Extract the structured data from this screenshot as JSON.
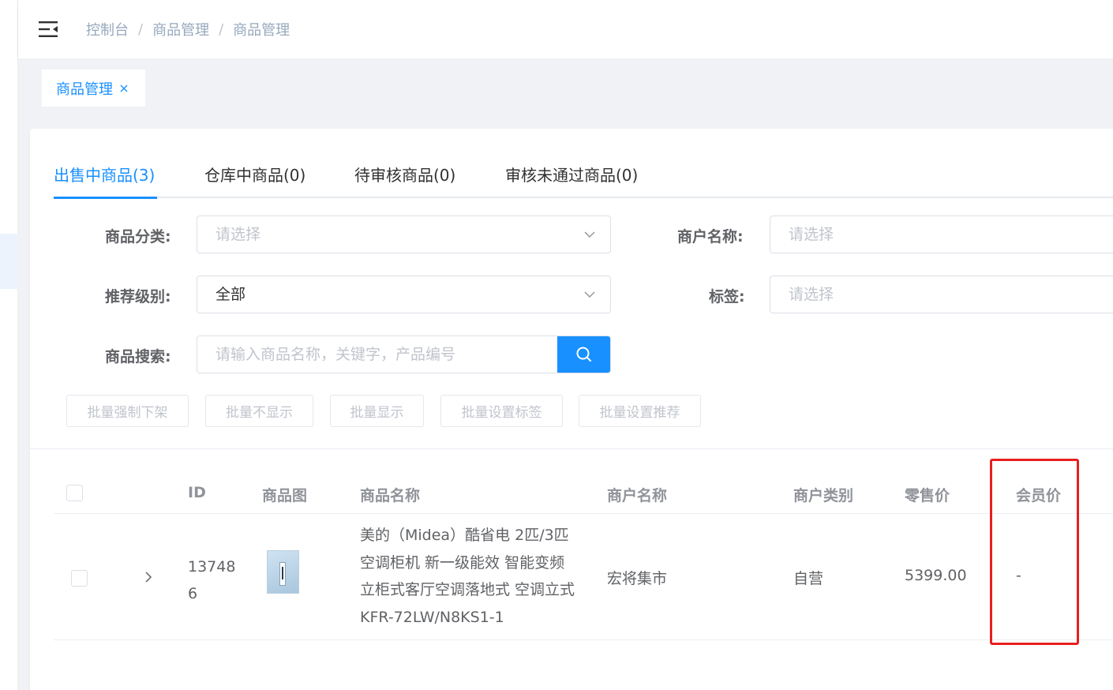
{
  "header": {
    "breadcrumb": [
      "控制台",
      "商品管理",
      "商品管理"
    ],
    "breadcrumb_sep": "/"
  },
  "tags": {
    "active_tag": "商品管理"
  },
  "tabs": [
    {
      "label": "出售中商品(3)",
      "active": true
    },
    {
      "label": "仓库中商品(0)",
      "active": false
    },
    {
      "label": "待审核商品(0)",
      "active": false
    },
    {
      "label": "审核未通过商品(0)",
      "active": false
    }
  ],
  "filters": {
    "category_label": "商品分类:",
    "category_placeholder": "请选择",
    "merchant_label": "商户名称:",
    "merchant_placeholder": "请选择",
    "recommend_label": "推荐级别:",
    "recommend_value": "全部",
    "tag_label": "标签:",
    "tag_placeholder": "请选择",
    "search_label": "商品搜索:",
    "search_placeholder": "请输入商品名称，关键字，产品编号"
  },
  "actions": [
    "批量强制下架",
    "批量不显示",
    "批量显示",
    "批量设置标签",
    "批量设置推荐"
  ],
  "table": {
    "columns": [
      "ID",
      "商品图",
      "商品名称",
      "商户名称",
      "商户类别",
      "零售价",
      "会员价"
    ],
    "rows": [
      {
        "id_line1": "13748",
        "id_line2": "6",
        "name_lines": [
          "美的（Midea）酷省电 2匹/3匹",
          "空调柜机 新一级能效 智能变频",
          "立柜式客厅空调落地式 空调立式",
          "KFR-72LW/N8KS1-1"
        ],
        "merchant": "宏将集市",
        "merchant_type": "自营",
        "retail_price": "5399.00",
        "member_price": "-"
      }
    ]
  },
  "colors": {
    "accent": "#1890ff",
    "highlight": "#e81f1f"
  }
}
